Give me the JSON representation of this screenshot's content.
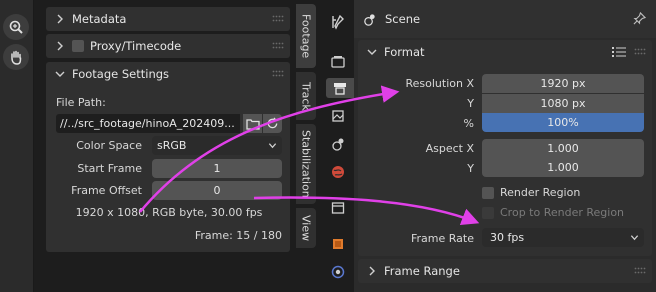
{
  "clip_panel": {
    "metadata_label": "Metadata",
    "proxy_label": "Proxy/Timecode",
    "footage_settings_label": "Footage Settings",
    "file_path_label": "File Path:",
    "file_path_value": "//../src_footage/hinoA_202409...",
    "color_space_label": "Color Space",
    "color_space_value": "sRGB",
    "start_frame_label": "Start Frame",
    "start_frame_value": "1",
    "frame_offset_label": "Frame Offset",
    "frame_offset_value": "0",
    "info_line": "1920 x 1080, RGB byte, 30.00 fps",
    "frame_line": "Frame: 15 / 180"
  },
  "vertical_tabs": [
    "Footage",
    "Track",
    "Stabilization",
    "View"
  ],
  "scene_panel": {
    "title": "Scene",
    "format_label": "Format",
    "resolution_x_label": "Resolution X",
    "resolution_x_value": "1920 px",
    "y_label": "Y",
    "resolution_y_value": "1080 px",
    "percent_label": "%",
    "percent_value": "100%",
    "aspect_x_label": "Aspect X",
    "aspect_x_value": "1.000",
    "aspect_y_label": "Y",
    "aspect_y_value": "1.000",
    "render_region_label": "Render Region",
    "crop_label": "Crop to Render Region",
    "frame_rate_label": "Frame Rate",
    "frame_rate_value": "30 fps",
    "frame_range_label": "Frame Range"
  },
  "colors": {
    "accent": "#4772b3",
    "arrow": "#e040e8",
    "panel": "#303030",
    "field": "#545454"
  },
  "icons": [
    "zoom-icon",
    "hand-icon",
    "folder-icon",
    "reload-icon",
    "tool-icon",
    "render-icon",
    "output-icon",
    "view-layer-icon",
    "scene-icon",
    "world-icon",
    "collection-icon",
    "object-icon",
    "physics-icon",
    "pin-icon",
    "list-icon"
  ]
}
